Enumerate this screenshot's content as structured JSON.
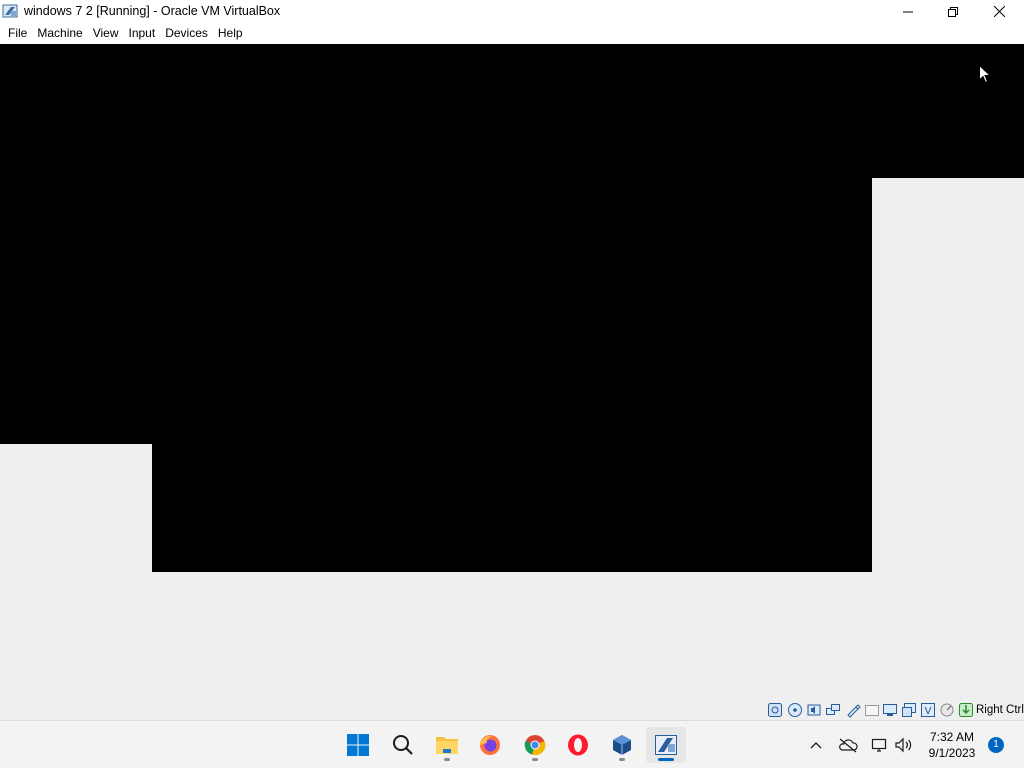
{
  "window": {
    "title": "windows 7 2 [Running] - Oracle VM VirtualBox",
    "controls": [
      "minimize",
      "restore",
      "close"
    ]
  },
  "menubar": {
    "items": [
      {
        "label": "File"
      },
      {
        "label": "Machine"
      },
      {
        "label": "View"
      },
      {
        "label": "Input"
      },
      {
        "label": "Devices"
      },
      {
        "label": "Help"
      }
    ]
  },
  "statusbar": {
    "icons": [
      "hard-disk-icon",
      "optical-drive-icon",
      "audio-icon",
      "network-icon",
      "usb-icon",
      "shared-folders-icon",
      "display-icon",
      "video-capture-icon",
      "cpu-icon",
      "mouse-integration-icon",
      "keyboard-capture-icon"
    ],
    "host_key": "Right Ctrl"
  },
  "taskbar": {
    "apps": [
      {
        "name": "start-button"
      },
      {
        "name": "search-button"
      },
      {
        "name": "file-explorer"
      },
      {
        "name": "firefox"
      },
      {
        "name": "chrome"
      },
      {
        "name": "opera"
      },
      {
        "name": "virtualbox-manager"
      },
      {
        "name": "virtualbox-vm-window"
      }
    ],
    "clock": {
      "time": "7:32 AM",
      "date": "9/1/2023"
    },
    "notification_count": "1"
  },
  "colors": {
    "accent": "#0067c0",
    "vm_screen": "#000000",
    "background": "#efefef"
  }
}
